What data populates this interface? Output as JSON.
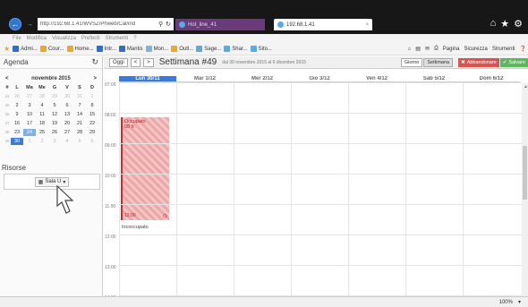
{
  "browser": {
    "address": "http://192.68.1.41/WVSZ/Phweb/Cal/ind",
    "tabs": [
      {
        "label": "Hot_line_41"
      },
      {
        "label": "192.68.1.41"
      }
    ],
    "menu": [
      "File",
      "Modifica",
      "Visualizza",
      "Preferiti",
      "Strumenti",
      "?"
    ],
    "favorites": [
      {
        "label": "Admi...",
        "color": "#2e6fcb"
      },
      {
        "label": "Cour...",
        "color": "#f4a622"
      },
      {
        "label": "Home...",
        "color": "#f4a622"
      },
      {
        "label": "Intr...",
        "color": "#2e6fcb"
      },
      {
        "label": "Mantis",
        "color": "#2e6fcb"
      },
      {
        "label": "Mon...",
        "color": "#7fb1e3"
      },
      {
        "label": "Outl...",
        "color": "#f4a622"
      },
      {
        "label": "Sage...",
        "color": "#59a9e5"
      },
      {
        "label": "Shar...",
        "color": "#59a9e5"
      },
      {
        "label": "Sito...",
        "color": "#59a9e5"
      }
    ],
    "commands": [
      "Pagina",
      "Sicurezza",
      "Strumenti"
    ],
    "zoom": "100%"
  },
  "sidebar": {
    "title": "Agenda",
    "mini_cal": {
      "month": "novembre 2015",
      "dow": [
        "#",
        "L",
        "Ma",
        "Me",
        "G",
        "V",
        "S",
        "D"
      ],
      "weeks": [
        [
          "44",
          "26",
          "27",
          "28",
          "29",
          "30",
          "31",
          "1"
        ],
        [
          "45",
          "2",
          "3",
          "4",
          "5",
          "6",
          "7",
          "8"
        ],
        [
          "46",
          "9",
          "10",
          "11",
          "12",
          "13",
          "14",
          "15"
        ],
        [
          "47",
          "16",
          "17",
          "18",
          "19",
          "20",
          "21",
          "22"
        ],
        [
          "48",
          "23",
          "24",
          "25",
          "26",
          "27",
          "28",
          "29"
        ],
        [
          "49",
          "30",
          "1",
          "2",
          "3",
          "4",
          "5",
          "6"
        ]
      ]
    },
    "resources_title": "Risorse",
    "resource_button": "Sala U"
  },
  "toolbar": {
    "today": "Oggi",
    "title": "Settimana #49",
    "subtitle": "dal 30 novembre 2015 al 6 dicembre 2015",
    "views": [
      "Giorno",
      "Settimana"
    ],
    "cancel": "Abbandonare",
    "save": "Salvare"
  },
  "calendar": {
    "days": [
      "Lun 30/11",
      "Mar 1/12",
      "Mer 2/12",
      "Gio 3/12",
      "Ven 4/12",
      "Sab 5/12",
      "Dom 6/12"
    ],
    "times": [
      "07:00",
      "08:00",
      "09:00",
      "10:00",
      "11:00",
      "12:00",
      "13:00",
      "14:00"
    ],
    "event": {
      "title": "Occupato",
      "start": "08 h",
      "end": "12:00"
    },
    "event2": {
      "title": "Incoccupato"
    }
  }
}
